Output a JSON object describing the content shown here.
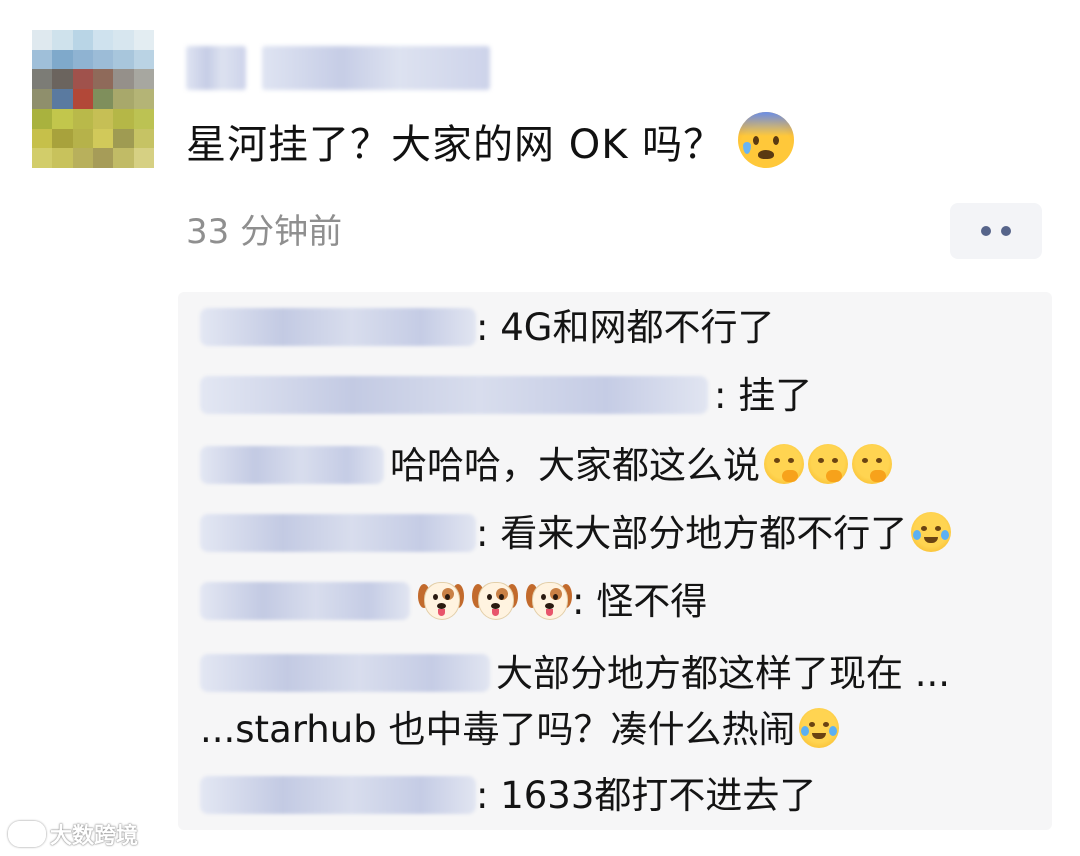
{
  "post": {
    "text": "星河挂了？大家的网 OK 吗？",
    "emoji": "anxious-face-with-sweat-icon",
    "time": "33 分钟前"
  },
  "comments": [
    {
      "text": ": 4G和网都不行了"
    },
    {
      "text": ": 挂了"
    },
    {
      "text": "哈哈哈，大家都这么说",
      "emoji": "face-with-hand-over-mouth-icon"
    },
    {
      "text": ": 看来大部分地方都不行了",
      "emoji": "face-with-tears-of-joy-icon"
    },
    {
      "text": ": 怪不得",
      "emoji": "dog-face-icon"
    },
    {
      "text": "大部分地方都这样了现在 ...",
      "text2": "...starhub 也中毒了吗？凑什么热闹",
      "emoji": "loudly-crying-face-icon"
    },
    {
      "text": ": 1633都打不进去了"
    }
  ],
  "watermark": "大数跨境"
}
